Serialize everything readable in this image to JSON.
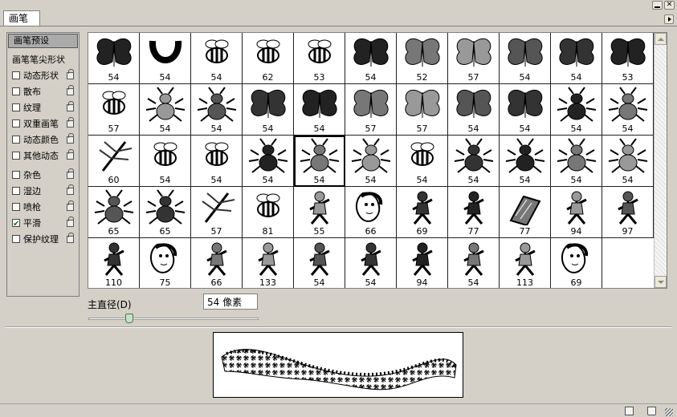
{
  "tab": {
    "label": "画笔"
  },
  "left_panel": {
    "preset_label": "画笔预设",
    "tip_shape_label": "画笔笔尖形状",
    "options": [
      {
        "label": "动态形状",
        "checked": false,
        "locked": true
      },
      {
        "label": "散布",
        "checked": false,
        "locked": true
      },
      {
        "label": "纹理",
        "checked": false,
        "locked": true
      },
      {
        "label": "双重画笔",
        "checked": false,
        "locked": true
      },
      {
        "label": "动态颜色",
        "checked": false,
        "locked": true
      },
      {
        "label": "其他动态",
        "checked": false,
        "locked": true
      },
      {
        "label": "杂色",
        "checked": false,
        "locked": true
      },
      {
        "label": "湿边",
        "checked": false,
        "locked": true
      },
      {
        "label": "喷枪",
        "checked": false,
        "locked": true
      },
      {
        "label": "平滑",
        "checked": true,
        "locked": true
      },
      {
        "label": "保护纹理",
        "checked": false,
        "locked": true
      }
    ]
  },
  "brushes": [
    {
      "size": "54",
      "icon": "moth-icon"
    },
    {
      "size": "54",
      "icon": "horseshoe-icon"
    },
    {
      "size": "54",
      "icon": "beehive-icon"
    },
    {
      "size": "62",
      "icon": "bee-cartoon-icon"
    },
    {
      "size": "53",
      "icon": "bee-flower-icon"
    },
    {
      "size": "54",
      "icon": "butterfly-outline-icon"
    },
    {
      "size": "52",
      "icon": "butterfly-gray-icon"
    },
    {
      "size": "57",
      "icon": "butterfly-square-icon"
    },
    {
      "size": "54",
      "icon": "butterfly-light-icon"
    },
    {
      "size": "54",
      "icon": "butterfly-gray2-icon"
    },
    {
      "size": "53",
      "icon": "butterfly-double-icon"
    },
    {
      "size": "57",
      "icon": "beetle-icon"
    },
    {
      "size": "54",
      "icon": "spider-icon"
    },
    {
      "size": "54",
      "icon": "ant-icon"
    },
    {
      "size": "54",
      "icon": "butterfly-black-icon"
    },
    {
      "size": "54",
      "icon": "butterfly-black2-icon"
    },
    {
      "size": "57",
      "icon": "butterfly-silhouette-icon"
    },
    {
      "size": "57",
      "icon": "butterfly-silhouette2-icon"
    },
    {
      "size": "54",
      "icon": "butterfly-pattern-icon"
    },
    {
      "size": "54",
      "icon": "moth-pattern-icon"
    },
    {
      "size": "54",
      "icon": "bug-icon"
    },
    {
      "size": "54",
      "icon": "bug2-icon"
    },
    {
      "size": "60",
      "icon": "dragonfly-icon"
    },
    {
      "size": "54",
      "icon": "beetle-striped-icon"
    },
    {
      "size": "54",
      "icon": "beetle-outline-icon"
    },
    {
      "size": "54",
      "icon": "cockroach-icon"
    },
    {
      "size": "54",
      "icon": "cockroach2-icon"
    },
    {
      "size": "54",
      "icon": "cricket-icon"
    },
    {
      "size": "54",
      "icon": "beetle-round-icon"
    },
    {
      "size": "54",
      "icon": "bug-long-icon"
    },
    {
      "size": "54",
      "icon": "bug-legs-icon"
    },
    {
      "size": "54",
      "icon": "fly-icon"
    },
    {
      "size": "54",
      "icon": "mantis-icon"
    },
    {
      "size": "65",
      "icon": "ant2-icon"
    },
    {
      "size": "65",
      "icon": "ant3-icon"
    },
    {
      "size": "57",
      "icon": "mosquito-icon"
    },
    {
      "size": "81",
      "icon": "wasp-icon"
    },
    {
      "size": "55",
      "icon": "woman-sitting-icon"
    },
    {
      "size": "66",
      "icon": "woman-face-icon"
    },
    {
      "size": "69",
      "icon": "dancer-icon"
    },
    {
      "size": "77",
      "icon": "archer-icon"
    },
    {
      "size": "77",
      "icon": "book-icon"
    },
    {
      "size": "94",
      "icon": "figure-icon"
    },
    {
      "size": "97",
      "icon": "man-icon"
    },
    {
      "size": "110",
      "icon": "lady-icon"
    },
    {
      "size": "75",
      "icon": "girl-face-icon"
    },
    {
      "size": "66",
      "icon": "dog-icon"
    },
    {
      "size": "133",
      "icon": "dancer2-icon"
    },
    {
      "size": "54",
      "icon": "clown-icon"
    },
    {
      "size": "54",
      "icon": "woman-icon"
    },
    {
      "size": "94",
      "icon": "runner-icon"
    },
    {
      "size": "54",
      "icon": "warrior-icon"
    },
    {
      "size": "113",
      "icon": "mermaid-icon"
    },
    {
      "size": "69",
      "icon": "face-profile-icon"
    }
  ],
  "selected_index": 26,
  "diameter": {
    "label": "主直径(D)",
    "value": "54 像素",
    "slider_fraction": 0.24
  }
}
